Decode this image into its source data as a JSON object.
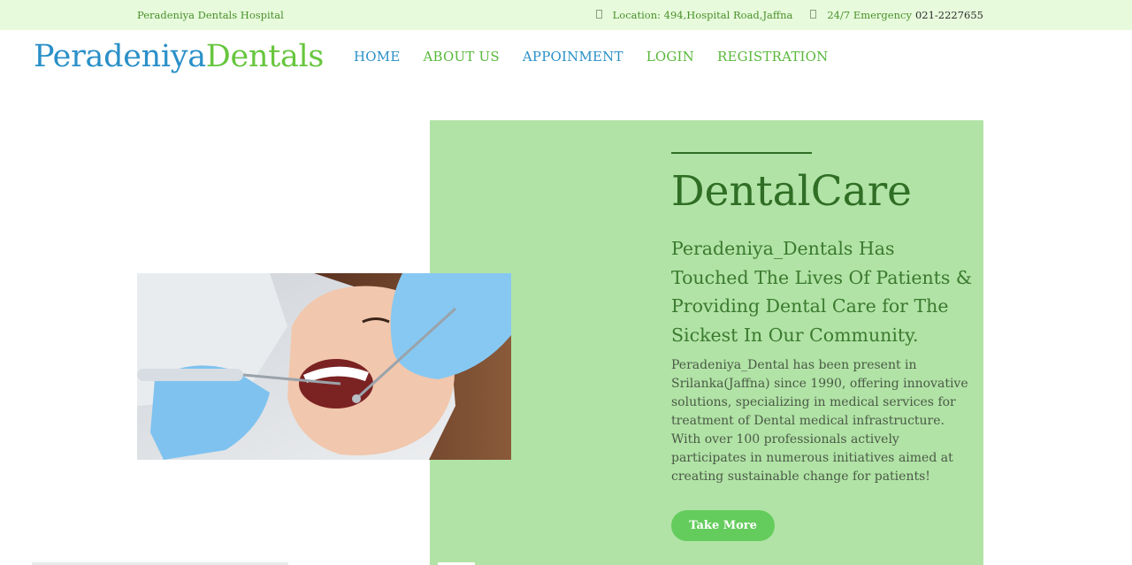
{
  "topbar": {
    "hospital_name": "Peradeniya Dentals Hospital",
    "location_label": "Location:",
    "location_value": "494,Hospital Road,Jaffna",
    "emergency_label": "24/7 Emergency",
    "emergency_phone": "021-2227655"
  },
  "header": {
    "logo_part1": "Peradeniya",
    "logo_part2": "Dentals",
    "nav": [
      {
        "label": "HOME"
      },
      {
        "label": "ABOUT US"
      },
      {
        "label": "APPOINMENT"
      },
      {
        "label": "LOGIN"
      },
      {
        "label": "REGISTRATION"
      }
    ]
  },
  "hero": {
    "title": "DentalCare",
    "subtitle": "Peradeniya_Dentals Has Touched The Lives Of Patients & Providing Dental Care for The Sickest In Our Community.",
    "body": "Peradeniya_Dental has been present in Srilanka(Jaffna) since 1990, offering innovative solutions, specializing in medical services for treatment of Dental medical infrastructure. With over 100 professionals actively participates in numerous initiatives aimed at creating sustainable change for patients!",
    "cta_label": "Take More"
  },
  "colors": {
    "brand_blue": "#2a90c8",
    "brand_green": "#67c63e",
    "panel_green": "#b1e3a6",
    "title_green": "#2f6e24",
    "cta_green": "#64cc5c"
  },
  "icons": [
    "location-icon",
    "phone-icon"
  ]
}
